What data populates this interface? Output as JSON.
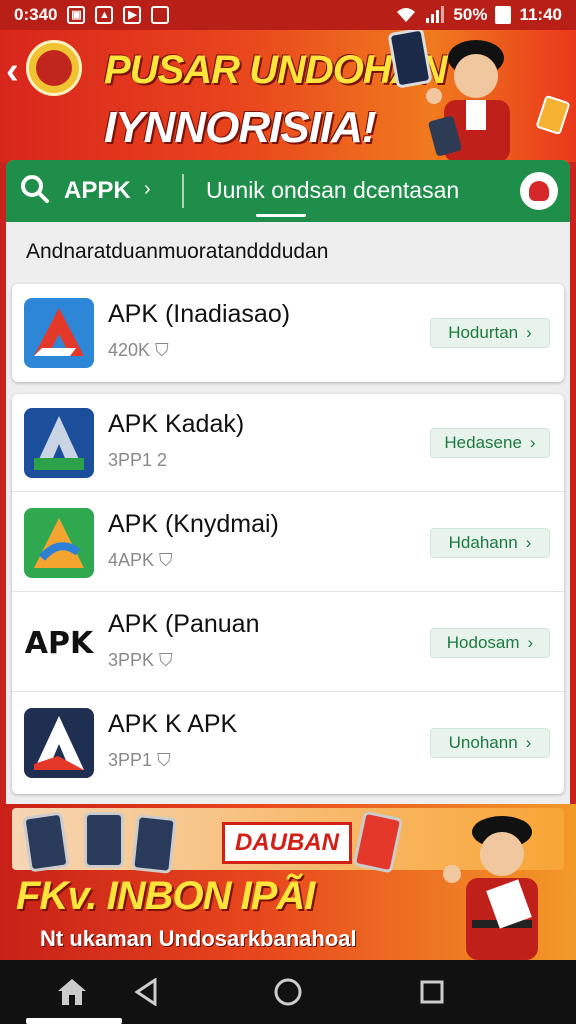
{
  "status_bar": {
    "time_left": "0:340",
    "battery_percent": "50%",
    "time_right": "11:40",
    "icons": [
      "gallery-icon",
      "drive-icon",
      "play-icon",
      "square-icon",
      "wifi-icon",
      "signal-icon",
      "battery-icon"
    ]
  },
  "header": {
    "title_line1": "PUSAR UNDOHAN",
    "title_line2": "IYNNORISIIA!"
  },
  "search": {
    "label": "APPK",
    "title": "Uunik ondsan dcentasan"
  },
  "list": {
    "subheader": "Andnaratduanmuoratandddudan",
    "items": [
      {
        "name": "APK (Inadiasao)",
        "meta": "420K",
        "button": "Hodurtan",
        "icon": "apk-arrow-red-blue-icon"
      },
      {
        "name": "APK Kadak)",
        "meta": "3PP1 2",
        "button": "Hedasene",
        "icon": "apk-a-blue-green-icon"
      },
      {
        "name": "APK (Knydmai)",
        "meta": "4APK",
        "button": "Hdahann",
        "icon": "apk-a-green-orange-icon"
      },
      {
        "name": "APK (Panuan",
        "meta": "3PPK",
        "button": "Hodosam",
        "icon": "apk-text-logo-icon"
      },
      {
        "name": "APK K APK",
        "meta": "3PP1",
        "button": "Unohann",
        "icon": "apk-a-navy-icon"
      }
    ]
  },
  "promo": {
    "badge": "DAUBAN",
    "headline": "FKv. INBON IPÃI",
    "subtitle": "Nt ukaman Undosarkbanahoal"
  },
  "colors": {
    "brand_red": "#c8231c",
    "brand_green": "#1e8e4a",
    "accent_yellow": "#ffe53b"
  }
}
